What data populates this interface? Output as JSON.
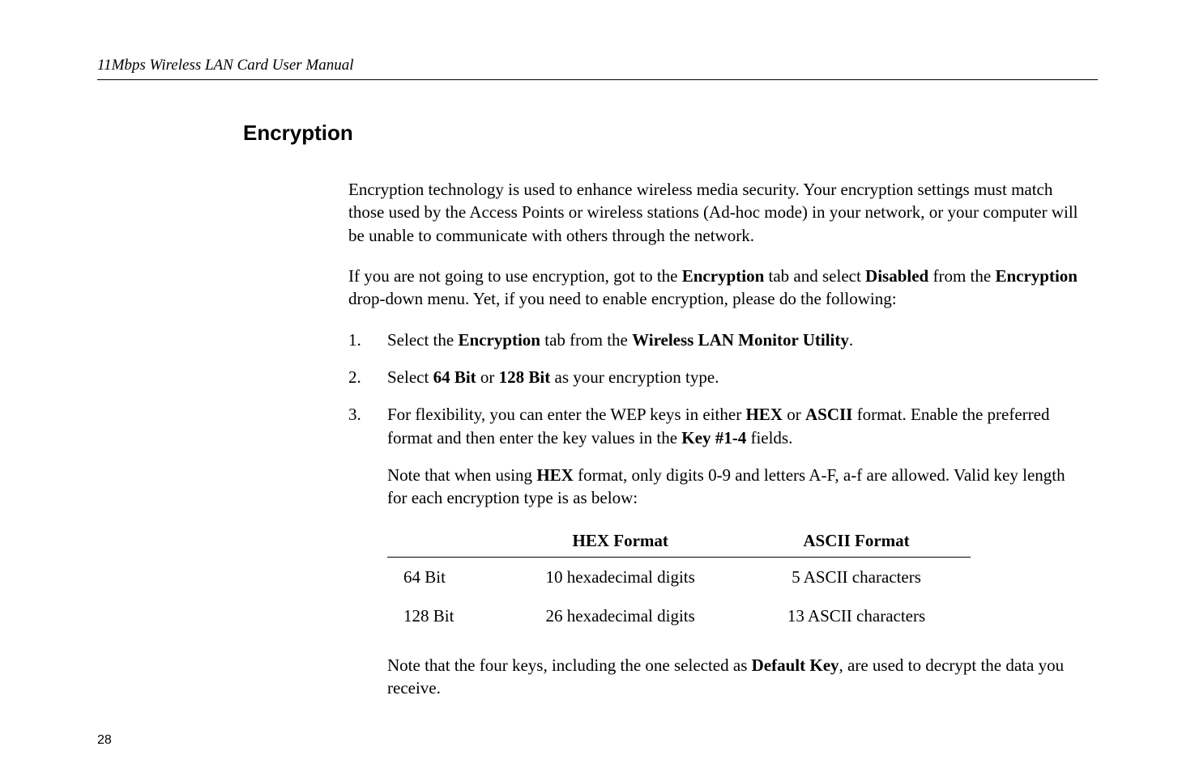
{
  "header": "11Mbps Wireless LAN Card User Manual",
  "section_title": "Encryption",
  "para1_a": "Encryption technology is used to enhance wireless media security. Your encryption settings must match those used by the Access Points or wireless stations (Ad-hoc mode) in your network, or your computer will be unable to communicate with others through the network.",
  "para2_a": "If you are not going to use encryption, got to the ",
  "para2_b": "Encryption",
  "para2_c": " tab and select ",
  "para2_d": "Disabled",
  "para2_e": " from the ",
  "para2_f": "Encryption",
  "para2_g": " drop-down menu. Yet, if you need to enable encryption, please do the following:",
  "list1_num": "1.",
  "list1_a": "Select the ",
  "list1_b": "Encryption",
  "list1_c": " tab from the ",
  "list1_d": "Wireless LAN Monitor Utility",
  "list1_e": ".",
  "list2_num": "2.",
  "list2_a": "Select ",
  "list2_b": "64 Bit",
  "list2_c": " or ",
  "list2_d": "128 Bit",
  "list2_e": " as your encryption type.",
  "list3_num": "3.",
  "list3_a": "For flexibility, you can enter the WEP keys in either ",
  "list3_b": "HEX",
  "list3_c": " or ",
  "list3_d": "ASCII",
  "list3_e": " format. Enable the preferred format and then enter the key values in the ",
  "list3_f": "Key #1-4",
  "list3_g": " fields.",
  "sub1_a": "Note that when using ",
  "sub1_b": "HEX",
  "sub1_c": " format, only digits 0-9 and letters A-F, a-f are allowed. Valid key length for each encryption type is as below:",
  "th1": "",
  "th2": "HEX Format",
  "th3": "ASCII Format",
  "row1_c1": "64 Bit",
  "row1_c2": "10 hexadecimal digits",
  "row1_c3": "5 ASCII characters",
  "row2_c1": "128 Bit",
  "row2_c2": "26 hexadecimal digits",
  "row2_c3": "13 ASCII characters",
  "sub2_a": "Note that the four keys, including the one selected as ",
  "sub2_b": "Default Key",
  "sub2_c": ", are used to decrypt the data you receive.",
  "page_number": "28"
}
